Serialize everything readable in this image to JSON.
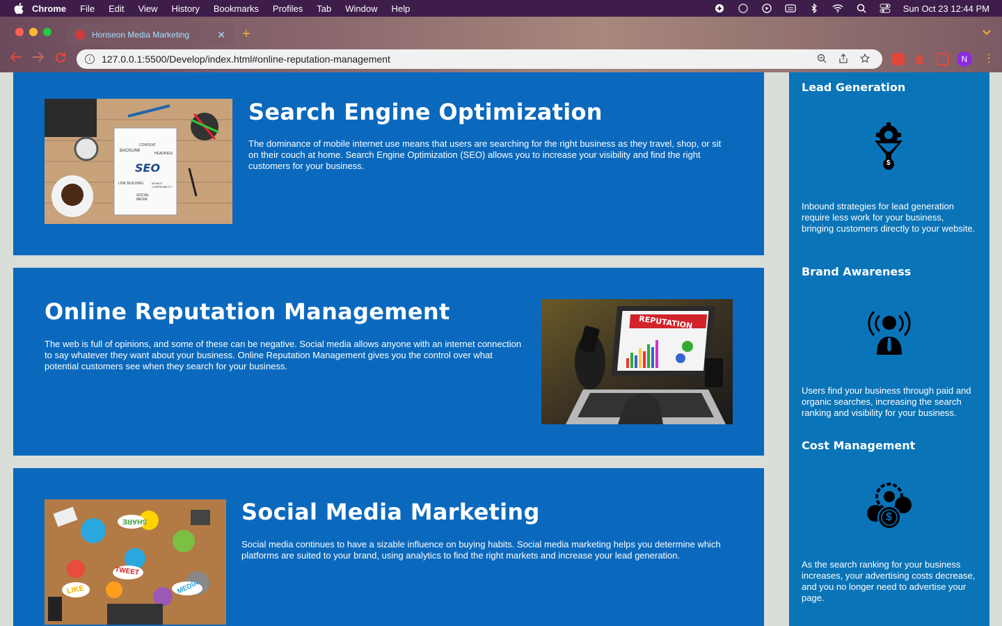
{
  "menubar": {
    "app": "Chrome",
    "items": [
      "File",
      "Edit",
      "View",
      "History",
      "Bookmarks",
      "Profiles",
      "Tab",
      "Window",
      "Help"
    ],
    "datetime": "Sun Oct 23  12:44 PM"
  },
  "browser": {
    "tab_title": "Horiseon Media Marketing",
    "tab_close": "✕",
    "new_tab": "+",
    "url": "127.0.0.1:5500/Develop/index.html#online-reputation-management",
    "profile_initial": "N"
  },
  "sections": [
    {
      "title": "Search Engine Optimization",
      "text": "The dominance of mobile internet use means that users are searching for the right business as they travel, shop, or sit on their couch at home. Search Engine Optimization (SEO) allows you to increase your visibility and find the right customers for your business.",
      "image_labels": [
        "SEO",
        "CONTENT",
        "BACKLINK",
        "HEADINGS",
        "LINK BUILDING",
        "MOBILE COMPATIBILITY",
        "SOCIAL MEDIA"
      ]
    },
    {
      "title": "Online Reputation Management",
      "text": "The web is full of opinions, and some of these can be negative. Social media allows anyone with an internet connection to say whatever they want about your business. Online Reputation Management gives you the control over what potential customers see when they search for your business.",
      "image_labels": [
        "REPUTATION"
      ]
    },
    {
      "title": "Social Media Marketing",
      "text": "Social media continues to have a sizable influence on buying habits. Social media marketing helps you determine which platforms are suited to your brand, using analytics to find the right markets and increase your lead generation.",
      "image_labels": [
        "SHARE",
        "TWEET",
        "LIKE",
        "MEDIA"
      ]
    }
  ],
  "benefits": [
    {
      "title": "Lead Generation",
      "text": "Inbound strategies for lead generation require less work for your business, bringing customers directly to your website.",
      "icon": "lead-funnel-icon",
      "icon_glyph": "$"
    },
    {
      "title": "Brand Awareness",
      "text": "Users find your business through paid and organic searches, increasing the search ranking and visibility for your business.",
      "icon": "broadcast-person-icon"
    },
    {
      "title": "Cost Management",
      "text": "As the search ranking for your business increases, your advertising costs decrease, and you no longer need to advertise your page.",
      "icon": "coins-gear-icon",
      "icon_glyph": "$"
    }
  ],
  "colors": {
    "card_blue": "#0a69bd",
    "aside_blue": "#0a74b8",
    "page_bg": "#d9ded9"
  }
}
